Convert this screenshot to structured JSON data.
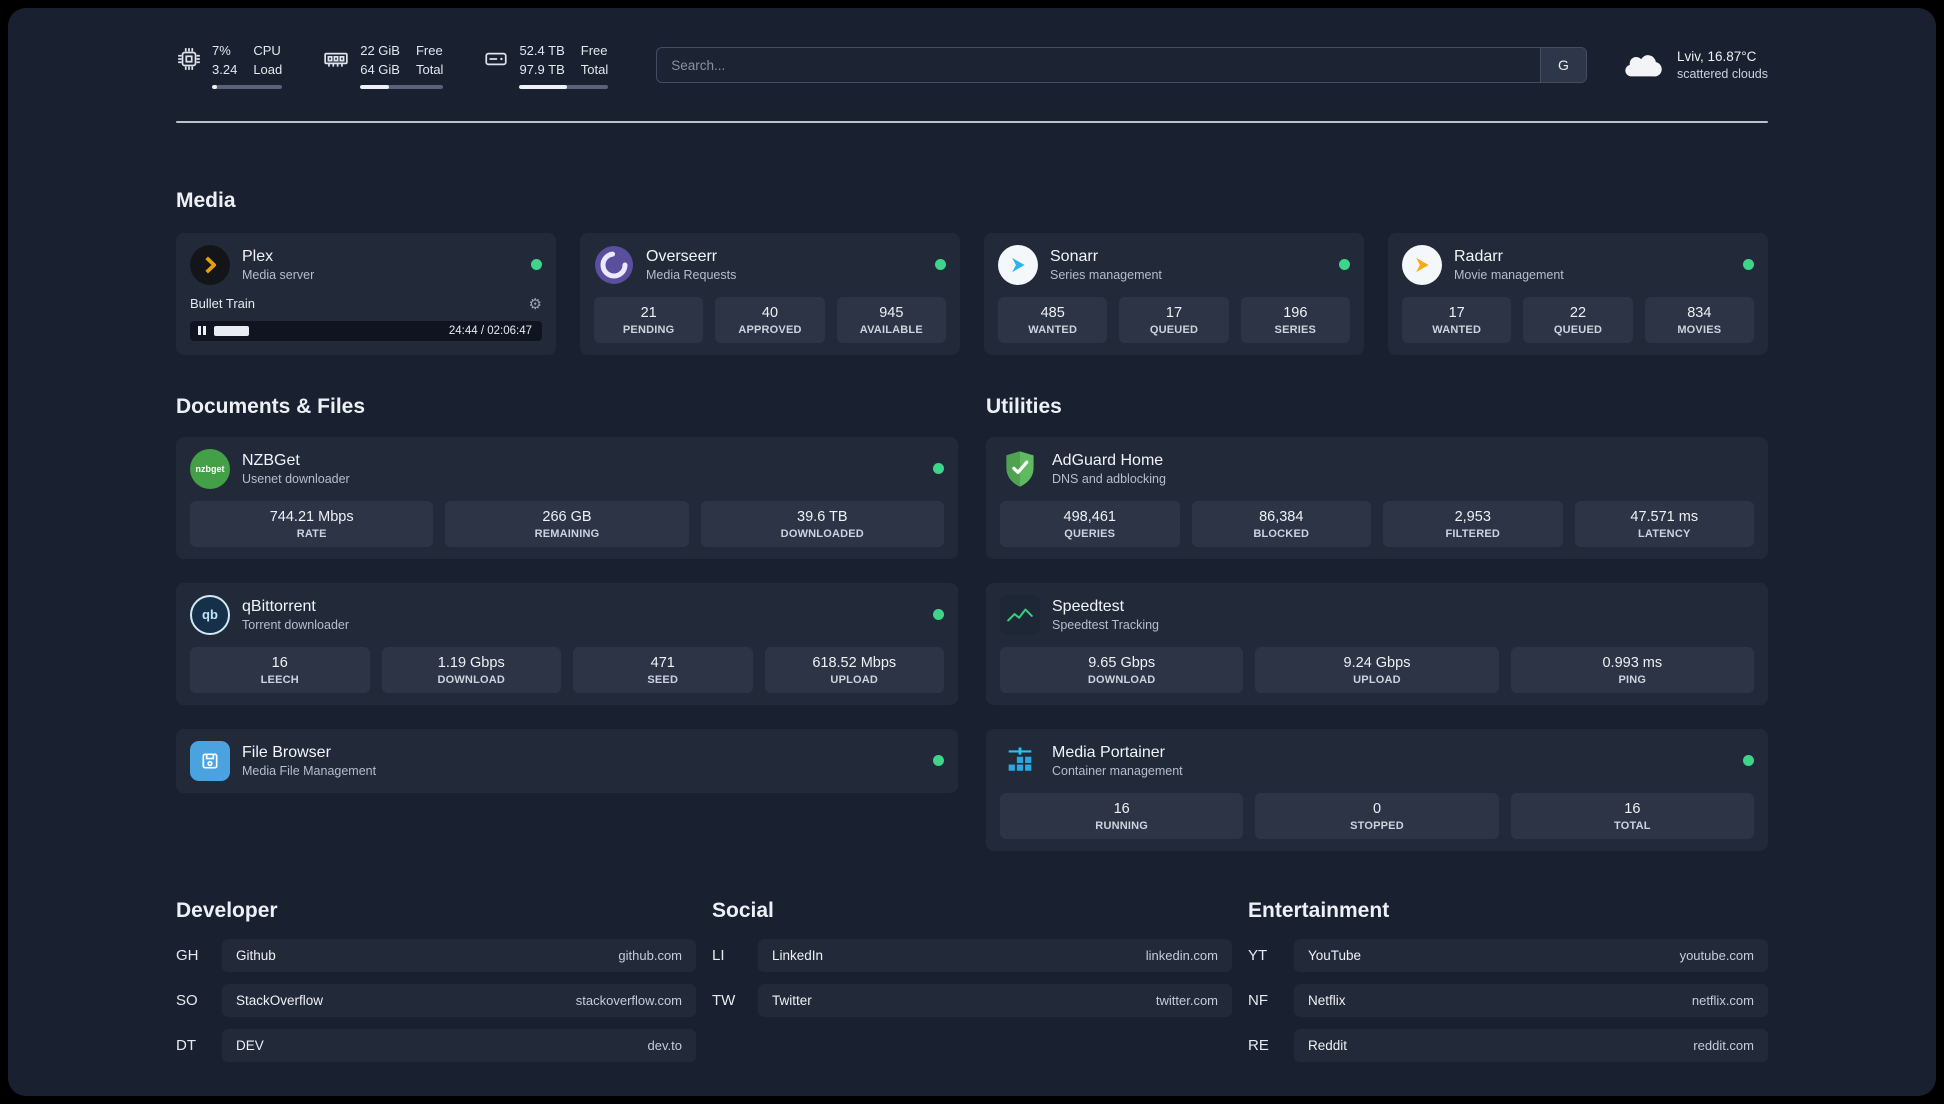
{
  "topbar": {
    "cpu": {
      "icon": "cpu-icon",
      "values": [
        "7%",
        "3.24"
      ],
      "labels": [
        "CPU",
        "Load"
      ],
      "progress": 7
    },
    "memory": {
      "icon": "memory-icon",
      "values": [
        "22 GiB",
        "64 GiB"
      ],
      "labels": [
        "Free",
        "Total"
      ],
      "progress": 34
    },
    "disk": {
      "icon": "disk-icon",
      "values": [
        "52.4 TB",
        "97.9 TB"
      ],
      "labels": [
        "Free",
        "Total"
      ],
      "progress": 54
    },
    "search": {
      "placeholder": "Search...",
      "button": "G"
    },
    "weather": {
      "icon": "cloud-icon",
      "line1": "Lviv, 16.87°C",
      "line2": "scattered clouds"
    }
  },
  "sections": {
    "media": {
      "title": "Media",
      "cards": [
        {
          "icon": "plex-icon",
          "name": "Plex",
          "subtitle": "Media server",
          "status": "online",
          "player": {
            "track": "Bullet Train",
            "time": "24:44 / 02:06:47",
            "progress": 11,
            "state": "paused"
          }
        },
        {
          "icon": "overseerr-icon",
          "name": "Overseerr",
          "subtitle": "Media Requests",
          "status": "online",
          "stats": [
            {
              "value": "21",
              "label": "PENDING"
            },
            {
              "value": "40",
              "label": "APPROVED"
            },
            {
              "value": "945",
              "label": "AVAILABLE"
            }
          ]
        },
        {
          "icon": "sonarr-icon",
          "name": "Sonarr",
          "subtitle": "Series management",
          "status": "online",
          "stats": [
            {
              "value": "485",
              "label": "WANTED"
            },
            {
              "value": "17",
              "label": "QUEUED"
            },
            {
              "value": "196",
              "label": "SERIES"
            }
          ]
        },
        {
          "icon": "radarr-icon",
          "name": "Radarr",
          "subtitle": "Movie management",
          "status": "online",
          "stats": [
            {
              "value": "17",
              "label": "WANTED"
            },
            {
              "value": "22",
              "label": "QUEUED"
            },
            {
              "value": "834",
              "label": "MOVIES"
            }
          ]
        }
      ]
    },
    "documents": {
      "title": "Documents & Files",
      "cards": [
        {
          "icon": "nzbget-icon",
          "icon_text": "nzbget",
          "name": "NZBGet",
          "subtitle": "Usenet downloader",
          "status": "online",
          "stats": [
            {
              "value": "744.21 Mbps",
              "label": "RATE"
            },
            {
              "value": "266 GB",
              "label": "REMAINING"
            },
            {
              "value": "39.6 TB",
              "label": "DOWNLOADED"
            }
          ]
        },
        {
          "icon": "qbittorrent-icon",
          "icon_text": "qb",
          "name": "qBittorrent",
          "subtitle": "Torrent downloader",
          "status": "online",
          "stats": [
            {
              "value": "16",
              "label": "LEECH"
            },
            {
              "value": "1.19 Gbps",
              "label": "DOWNLOAD"
            },
            {
              "value": "471",
              "label": "SEED"
            },
            {
              "value": "618.52 Mbps",
              "label": "UPLOAD"
            }
          ]
        },
        {
          "icon": "filebrowser-icon",
          "name": "File Browser",
          "subtitle": "Media File Management",
          "status": "online",
          "stats": []
        }
      ]
    },
    "utilities": {
      "title": "Utilities",
      "cards": [
        {
          "icon": "adguard-icon",
          "name": "AdGuard Home",
          "subtitle": "DNS and adblocking",
          "stats": [
            {
              "value": "498,461",
              "label": "QUERIES"
            },
            {
              "value": "86,384",
              "label": "BLOCKED"
            },
            {
              "value": "2,953",
              "label": "FILTERED"
            },
            {
              "value": "47.571 ms",
              "label": "LATENCY"
            }
          ]
        },
        {
          "icon": "speedtest-icon",
          "name": "Speedtest",
          "subtitle": "Speedtest Tracking",
          "stats": [
            {
              "value": "9.65 Gbps",
              "label": "DOWNLOAD"
            },
            {
              "value": "9.24 Gbps",
              "label": "UPLOAD"
            },
            {
              "value": "0.993 ms",
              "label": "PING"
            }
          ]
        },
        {
          "icon": "portainer-icon",
          "name": "Media Portainer",
          "subtitle": "Container management",
          "status": "online",
          "stats": [
            {
              "value": "16",
              "label": "RUNNING"
            },
            {
              "value": "0",
              "label": "STOPPED"
            },
            {
              "value": "16",
              "label": "TOTAL"
            }
          ]
        }
      ]
    },
    "bookmarks": [
      {
        "title": "Developer",
        "items": [
          {
            "abbr": "GH",
            "name": "Github",
            "url": "github.com"
          },
          {
            "abbr": "SO",
            "name": "StackOverflow",
            "url": "stackoverflow.com"
          },
          {
            "abbr": "DT",
            "name": "DEV",
            "url": "dev.to"
          }
        ]
      },
      {
        "title": "Social",
        "items": [
          {
            "abbr": "LI",
            "name": "LinkedIn",
            "url": "linkedin.com"
          },
          {
            "abbr": "TW",
            "name": "Twitter",
            "url": "twitter.com"
          }
        ]
      },
      {
        "title": "Entertainment",
        "items": [
          {
            "abbr": "YT",
            "name": "YouTube",
            "url": "youtube.com"
          },
          {
            "abbr": "NF",
            "name": "Netflix",
            "url": "netflix.com"
          },
          {
            "abbr": "RE",
            "name": "Reddit",
            "url": "reddit.com"
          }
        ]
      }
    ]
  },
  "colors": {
    "status_online": "#3ed489",
    "plex_accent": "#e5a00d",
    "sonarr_blue": "#2bb3ec",
    "radarr_orange": "#f7a916",
    "nzbget_green": "#43a047",
    "filebrowser_blue": "#4aa3df",
    "adguard_green": "#5fba61",
    "speedtest_green": "#37d07e",
    "portainer_blue": "#29a8e0",
    "overseerr_purple": "#5a4e9e"
  }
}
